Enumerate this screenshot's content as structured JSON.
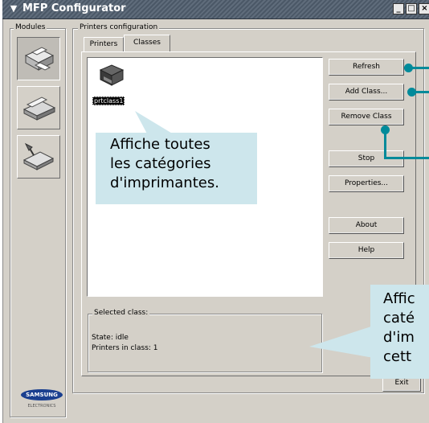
{
  "window": {
    "title": "MFP Configurator",
    "controls": [
      "_",
      "□",
      "×"
    ]
  },
  "modules": {
    "label": "Modules",
    "items": [
      "printer-module-icon",
      "scanner-module-icon",
      "port-module-icon"
    ]
  },
  "config": {
    "label": "Printers configuration",
    "tabs": [
      {
        "label": "Printers",
        "active": false
      },
      {
        "label": "Classes",
        "active": true
      }
    ]
  },
  "class_list": [
    {
      "name": "prtclass1",
      "icon": "printer-class-icon"
    }
  ],
  "buttons": {
    "refresh": "Refresh",
    "add_class": "Add Class...",
    "remove_class": "Remove Class",
    "stop": "Stop",
    "properties": "Properties...",
    "about": "About",
    "help": "Help",
    "exit": "Exit"
  },
  "selected_class": {
    "label": "Selected class:",
    "state": "State: idle",
    "printers": "Printers in class: 1"
  },
  "brand": {
    "name": "SAMSUNG",
    "sub": "ELECTRONICS"
  },
  "annotations": {
    "list_note_line1": "Affiche toutes",
    "list_note_line2": "les catégories",
    "list_note_line3": "d'imprimantes.",
    "status_note_line1": "Affic",
    "status_note_line2": "caté",
    "status_note_line3": "d'im",
    "status_note_line4": "cett"
  },
  "colors": {
    "callout": "#cde6ec",
    "pointer": "#008a9a",
    "titlebar": "#4b5867",
    "panel": "#d4d0c8"
  }
}
